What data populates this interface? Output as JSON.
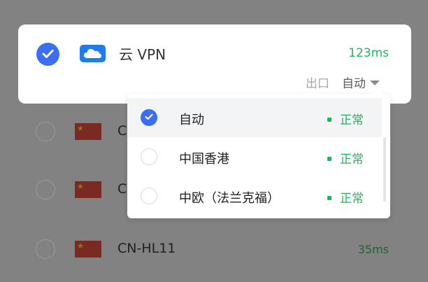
{
  "vpn": {
    "name": "云 VPN",
    "latency": "123ms",
    "exit_label": "出口",
    "mode": "自动"
  },
  "dropdown": {
    "options": [
      {
        "label": "自动",
        "status": "正常",
        "selected": true
      },
      {
        "label": "中国香港",
        "status": "正常",
        "selected": false
      },
      {
        "label": "中欧（法兰克福）",
        "status": "正常",
        "selected": false
      }
    ]
  },
  "servers": [
    {
      "name": "CN",
      "latency": ""
    },
    {
      "name": "C",
      "latency": ""
    },
    {
      "name": "CN-HL11",
      "latency": "35ms"
    }
  ],
  "colors": {
    "accent": "#3b6ef6",
    "status_ok": "#22b559",
    "cloud_icon": "#1d7cf2"
  }
}
